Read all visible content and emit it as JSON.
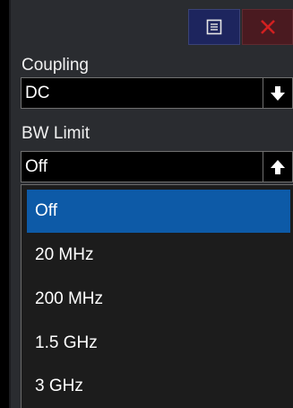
{
  "colors": {
    "panel_bg": "#2a2c30",
    "menu_button_bg": "#1d255e",
    "close_button_bg": "#4a1a20",
    "close_x": "#d22020",
    "selected_bg": "#0d5aa7"
  },
  "icons": {
    "menu": "menu-icon",
    "close": "close-icon",
    "down": "arrow-down-icon",
    "up": "arrow-up-icon"
  },
  "coupling": {
    "label": "Coupling",
    "value": "DC"
  },
  "bw_limit": {
    "label": "BW Limit",
    "value": "Off",
    "options": [
      {
        "label": "Off",
        "selected": true
      },
      {
        "label": "20 MHz",
        "selected": false
      },
      {
        "label": "200 MHz",
        "selected": false
      },
      {
        "label": "1.5 GHz",
        "selected": false
      },
      {
        "label": "3 GHz",
        "selected": false
      }
    ]
  }
}
